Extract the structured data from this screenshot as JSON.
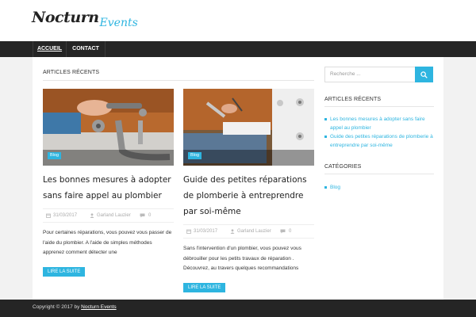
{
  "site": {
    "logo_main": "Nocturn",
    "logo_sub": "Events"
  },
  "nav": {
    "items": [
      {
        "label": "ACCUEIL",
        "active": true
      },
      {
        "label": "CONTACT",
        "active": false
      }
    ]
  },
  "main": {
    "section_title": "ARTICLES RÉCENTS",
    "posts": [
      {
        "category": "Blog",
        "title": "Les bonnes mesures à adopter sans faire appel au plombier",
        "date": "31/03/2017",
        "author": "Garland Lauzier",
        "comments": "0",
        "excerpt": "Pour certaines réparations, vous pouvez vous passer de l'aide du plombier. A l'aide de simples méthodes apprenez comment détecter une",
        "read_more": "LIRE LA SUITE"
      },
      {
        "category": "Blog",
        "title": "Guide des petites réparations de plomberie à entreprendre par soi-même",
        "date": "31/03/2017",
        "author": "Garland Lauzier",
        "comments": "0",
        "excerpt": "Sans l'intervention d'un plombier, vous pouvez vous débrouiller pour les petits travaux de réparation . Découvrez, au travers quelques recommandations",
        "read_more": "LIRE LA SUITE"
      }
    ]
  },
  "sidebar": {
    "search_placeholder": "Recherche ...",
    "recent_title": "ARTICLES RÉCENTS",
    "recent_links": [
      "Les bonnes mesures à adopter sans faire appel au plombier",
      "Guide des petites réparations de plomberie à entreprendre par soi-même"
    ],
    "categories_title": "CATÉGORIES",
    "categories": [
      "Blog"
    ]
  },
  "footer": {
    "prefix": "Copyright © 2017 by",
    "link": "Nocturn Events"
  },
  "colors": {
    "accent": "#2eb5e0",
    "dark": "#252525"
  },
  "icons": [
    "search-icon",
    "calendar-icon",
    "user-icon",
    "comment-icon",
    "bullet-icon"
  ]
}
